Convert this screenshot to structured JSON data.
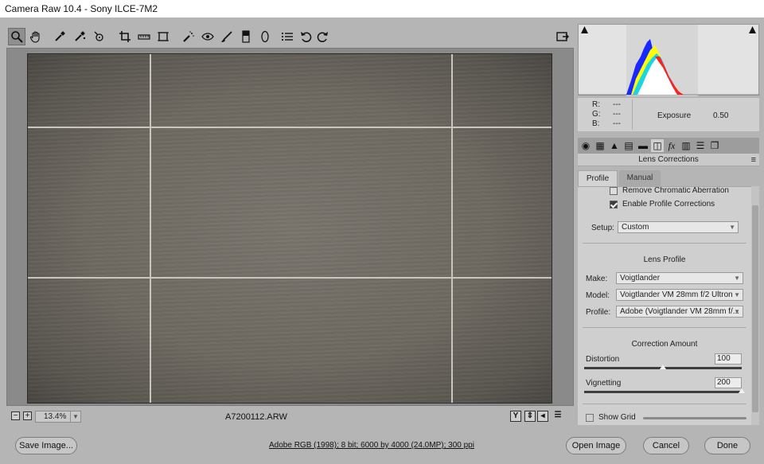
{
  "title": "Camera Raw 10.4  -  Sony ILCE-7M2",
  "toolbar": {
    "tools": [
      "zoom-icon",
      "hand-icon",
      "white-balance-icon",
      "color-sampler-icon",
      "targeted-adjustment-icon",
      "crop-icon",
      "straighten-icon",
      "transform-icon",
      "spot-removal-icon",
      "red-eye-icon",
      "adjustment-brush-icon",
      "graduated-filter-icon",
      "radial-filter-icon",
      "preferences-icon",
      "rotate-ccw-icon",
      "rotate-cw-icon"
    ],
    "toggle_fullscreen": "fullscreen-icon"
  },
  "canvas": {
    "zoom_level": "13.4%",
    "filename": "A7200112.ARW"
  },
  "footer": {
    "save_label": "Save Image...",
    "workflow_text": "Adobe RGB (1998); 8 bit; 6000 by 4000 (24.0MP); 300 ppi",
    "open_label": "Open Image",
    "cancel_label": "Cancel",
    "done_label": "Done"
  },
  "histogram": {
    "r_label": "R:",
    "g_label": "G:",
    "b_label": "B:",
    "r_value": "---",
    "g_value": "---",
    "b_value": "---",
    "exposure_label": "Exposure",
    "exposure_value": "0.50"
  },
  "panel": {
    "title": "Lens Corrections",
    "tabs": {
      "profile": "Profile",
      "manual": "Manual"
    },
    "remove_ca_label": "Remove Chromatic Aberration",
    "remove_ca_checked": false,
    "enable_profile_label": "Enable Profile Corrections",
    "enable_profile_checked": true,
    "setup_label": "Setup:",
    "setup_value": "Custom",
    "lens_profile_heading": "Lens Profile",
    "make_label": "Make:",
    "make_value": "Voigtlander",
    "model_label": "Model:",
    "model_value": "Voigtlander VM 28mm f/2 Ultron",
    "profile_label": "Profile:",
    "profile_value": "Adobe (Voigtlander VM 28mm f/...",
    "correction_heading": "Correction Amount",
    "distortion_label": "Distortion",
    "distortion_value": "100",
    "vignetting_label": "Vignetting",
    "vignetting_value": "200",
    "show_grid_label": "Show Grid"
  }
}
